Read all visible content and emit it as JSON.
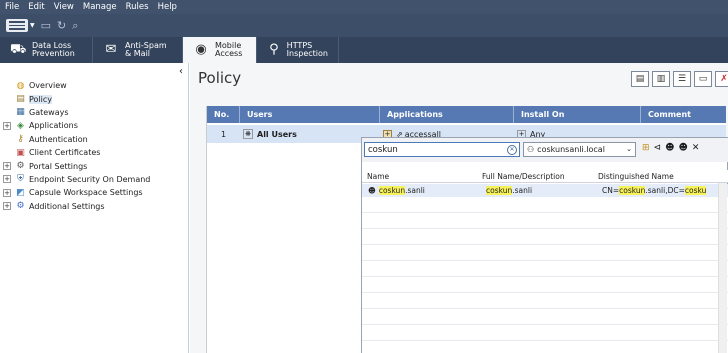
{
  "menu": [
    "File",
    "Edit",
    "View",
    "Manage",
    "Rules",
    "Help"
  ],
  "tabs": [
    {
      "line1": "Data Loss",
      "line2": "Prevention"
    },
    {
      "line1": "Anti-Spam",
      "line2": "& Mail"
    },
    {
      "line1": "Mobile",
      "line2": "Access"
    },
    {
      "line1": "HTTPS",
      "line2": "Inspection"
    }
  ],
  "sidebar": {
    "items": [
      {
        "label": "Overview",
        "icon": "overview-icon"
      },
      {
        "label": "Policy",
        "icon": "policy-icon",
        "selected": true
      },
      {
        "label": "Gateways",
        "icon": "gateways-icon"
      },
      {
        "label": "Applications",
        "icon": "applications-icon"
      },
      {
        "label": "Authentication",
        "icon": "authentication-icon"
      },
      {
        "label": "Client Certificates",
        "icon": "certificates-icon"
      },
      {
        "label": "Portal Settings",
        "icon": "portal-icon"
      },
      {
        "label": "Endpoint Security On Demand",
        "icon": "endpoint-icon"
      },
      {
        "label": "Capsule Workspace Settings",
        "icon": "capsule-icon"
      },
      {
        "label": "Additional Settings",
        "icon": "settings-icon"
      }
    ]
  },
  "main": {
    "title": "Policy"
  },
  "grid": {
    "headers": [
      "No.",
      "Users",
      "Applications",
      "Install On",
      "Comment"
    ],
    "row": {
      "no": "1",
      "users": "All Users",
      "applications": "accessall",
      "install_on": "Any"
    }
  },
  "popup": {
    "search_value": "coskun",
    "domain": "coskunsanli.local",
    "headers": [
      "Name",
      "Full Name/Description",
      "Distinguished Name"
    ],
    "result": {
      "name_hl": "coskun",
      "name_rest": ".sanli",
      "full_hl": "coskun",
      "full_rest": ".sanli",
      "dn_pre": "CN=",
      "dn_hl1": "coskun",
      "dn_mid": ".sanli,DC=",
      "dn_hl2": "cosku"
    }
  }
}
